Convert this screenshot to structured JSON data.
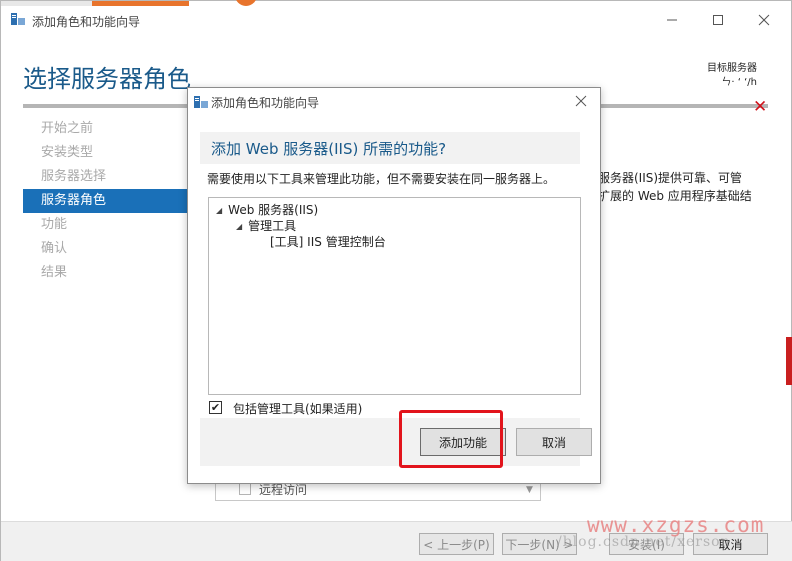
{
  "main_window": {
    "title": "添加角色和功能向导",
    "page_title": "选择服务器角色",
    "target_label": "目标服务器",
    "target_value": "ㄣ· ‘ ‘/h",
    "nav_items": [
      "开始之前",
      "安装类型",
      "服务器选择",
      "服务器角色",
      "功能",
      "确认",
      "结果"
    ],
    "active_nav_index": 3,
    "description_lines": [
      "服务器(IIS)提供可靠、可管",
      "扩展的 Web 应用程序基础结"
    ],
    "background_list_item": "远程访问",
    "footer": {
      "prev": "< 上一步(P)",
      "next": "下一步(N) >",
      "install": "安装(I)",
      "cancel": "取消"
    },
    "watermark": "www.xzgzs.com",
    "watermark_sub": "/blog.csdn.net/xerson"
  },
  "dialog": {
    "title": "添加角色和功能向导",
    "heading": "添加 Web 服务器(IIS) 所需的功能?",
    "description": "需要使用以下工具来管理此功能，但不需要安装在同一服务器上。",
    "tree": [
      {
        "label": "Web 服务器(IIS)",
        "expanded": true
      },
      {
        "label": "管理工具",
        "expanded": true
      },
      {
        "label": "[工具] IIS 管理控制台"
      }
    ],
    "include_tools_label": "包括管理工具(如果适用)",
    "include_tools_checked": true,
    "check_mark": "✔",
    "add_button": "添加功能",
    "cancel_button": "取消"
  },
  "colors": {
    "accent_blue": "#1a70b8",
    "title_blue": "#1a5a8a",
    "highlight_red": "#e2141c",
    "error_red": "#d0121b"
  }
}
